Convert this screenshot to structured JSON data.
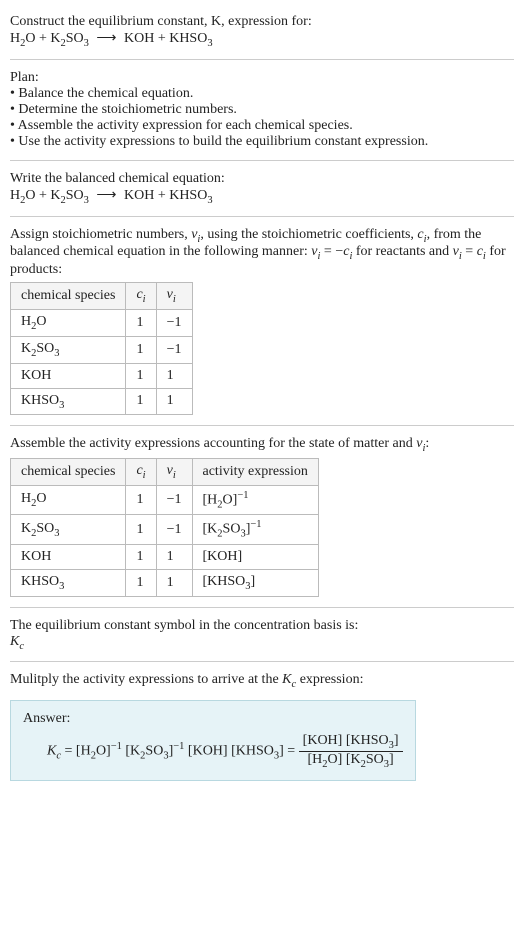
{
  "prompt_line1": "Construct the equilibrium constant, K, expression for:",
  "equation_lhs1": "H",
  "equation_lhs1_sub": "2",
  "equation_lhs1b": "O + K",
  "equation_lhs1b_sub": "2",
  "equation_lhs1c": "SO",
  "equation_lhs1c_sub": "3",
  "arrow": "⟶",
  "equation_rhs1": "KOH + KHSO",
  "equation_rhs1_sub": "3",
  "plan_title": "Plan:",
  "plan1": "• Balance the chemical equation.",
  "plan2": "• Determine the stoichiometric numbers.",
  "plan3": "• Assemble the activity expression for each chemical species.",
  "plan4": "• Use the activity expressions to build the equilibrium constant expression.",
  "balanced_title": "Write the balanced chemical equation:",
  "assign_text1": "Assign stoichiometric numbers, ",
  "assign_nu": "ν",
  "assign_i": "i",
  "assign_text2": ", using the stoichiometric coefficients, ",
  "assign_c": "c",
  "assign_text3": ", from the balanced chemical equation in the following manner: ",
  "assign_eq1a": "ν",
  "assign_eq1b": " = −",
  "assign_eq1c": "c",
  "assign_text4": " for reactants and ",
  "assign_eq2b": " = ",
  "assign_text5": " for products:",
  "table1_h1": "chemical species",
  "table1_h2_a": "c",
  "table1_h2_b": "i",
  "table1_h3_a": "ν",
  "table1_h3_b": "i",
  "t1r1c1a": "H",
  "t1r1c1a_sub": "2",
  "t1r1c1b": "O",
  "t1r1c2": "1",
  "t1r1c3": "−1",
  "t1r2c1a": "K",
  "t1r2c1a_sub": "2",
  "t1r2c1b": "SO",
  "t1r2c1b_sub": "3",
  "t1r2c2": "1",
  "t1r2c3": "−1",
  "t1r3c1": "KOH",
  "t1r3c2": "1",
  "t1r3c3": "1",
  "t1r4c1a": "KHSO",
  "t1r4c1a_sub": "3",
  "t1r4c2": "1",
  "t1r4c3": "1",
  "assemble_text1": "Assemble the activity expressions accounting for the state of matter and ",
  "assemble_text2": ":",
  "table2_h4": "activity expression",
  "t2r1c4a": "[H",
  "t2r1c4a_sub": "2",
  "t2r1c4b": "O]",
  "t2r1c4_sup": "−1",
  "t2r2c4a": "[K",
  "t2r2c4a_sub": "2",
  "t2r2c4b": "SO",
  "t2r2c4b_sub": "3",
  "t2r2c4c": "]",
  "t2r2c4_sup": "−1",
  "t2r3c4": "[KOH]",
  "t2r4c4a": "[KHSO",
  "t2r4c4a_sub": "3",
  "t2r4c4b": "]",
  "kc_line1": "The equilibrium constant symbol in the concentration basis is:",
  "kc_sym_a": "K",
  "kc_sym_b": "c",
  "mult_line": "Mulitply the activity expressions to arrive at the ",
  "mult_line2": " expression:",
  "answer_label": "Answer:",
  "ans_a": "K",
  "ans_b": " = [H",
  "ans_c": "O]",
  "ans_d": " [K",
  "ans_e": "SO",
  "ans_f": "]",
  "ans_g": " [KOH] [KHSO",
  "ans_h": "] = ",
  "frac_num_a": "[KOH] [KHSO",
  "frac_num_b": "]",
  "frac_den_a": "[H",
  "frac_den_b": "O] [K",
  "frac_den_c": "SO",
  "frac_den_d": "]",
  "chart_data": {
    "type": "table",
    "tables": [
      {
        "title": "stoichiometric numbers",
        "columns": [
          "chemical species",
          "c_i",
          "ν_i"
        ],
        "rows": [
          [
            "H2O",
            1,
            -1
          ],
          [
            "K2SO3",
            1,
            -1
          ],
          [
            "KOH",
            1,
            1
          ],
          [
            "KHSO3",
            1,
            1
          ]
        ]
      },
      {
        "title": "activity expressions",
        "columns": [
          "chemical species",
          "c_i",
          "ν_i",
          "activity expression"
        ],
        "rows": [
          [
            "H2O",
            1,
            -1,
            "[H2O]^-1"
          ],
          [
            "K2SO3",
            1,
            -1,
            "[K2SO3]^-1"
          ],
          [
            "KOH",
            1,
            1,
            "[KOH]"
          ],
          [
            "KHSO3",
            1,
            1,
            "[KHSO3]"
          ]
        ]
      }
    ]
  }
}
